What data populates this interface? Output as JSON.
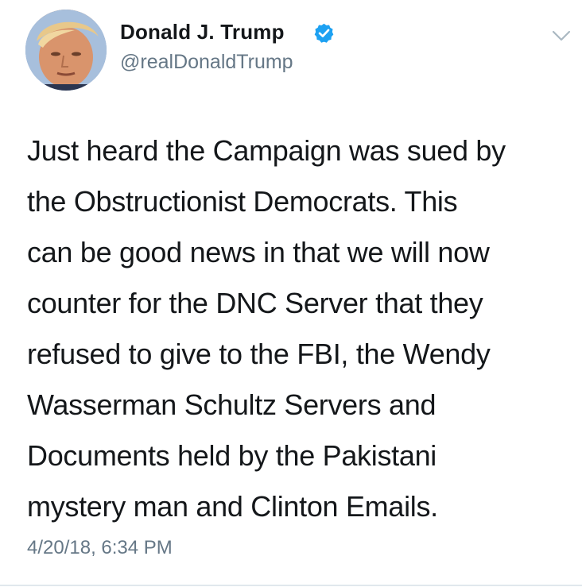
{
  "author": {
    "display_name": "Donald J. Trump",
    "handle": "@realDonaldTrump",
    "verified": true,
    "avatar_icon": "profile-photo",
    "verified_icon": "verified-badge-icon",
    "verified_color": "#1da1f2"
  },
  "menu": {
    "icon": "chevron-down-icon"
  },
  "tweet": {
    "text": "Just heard the Campaign was sued by\nthe Obstructionist Democrats. This\ncan be good news in that we will now\ncounter for the DNC Server that they\nrefused to give to the FBI, the Wendy\nWasserman Schultz Servers and\nDocuments held by the Pakistani\nmystery man and Clinton Emails.",
    "timestamp": "4/20/18, 6:34 PM"
  },
  "colors": {
    "text_primary": "#14171a",
    "text_secondary": "#657786",
    "divider": "#e1e8ed"
  }
}
